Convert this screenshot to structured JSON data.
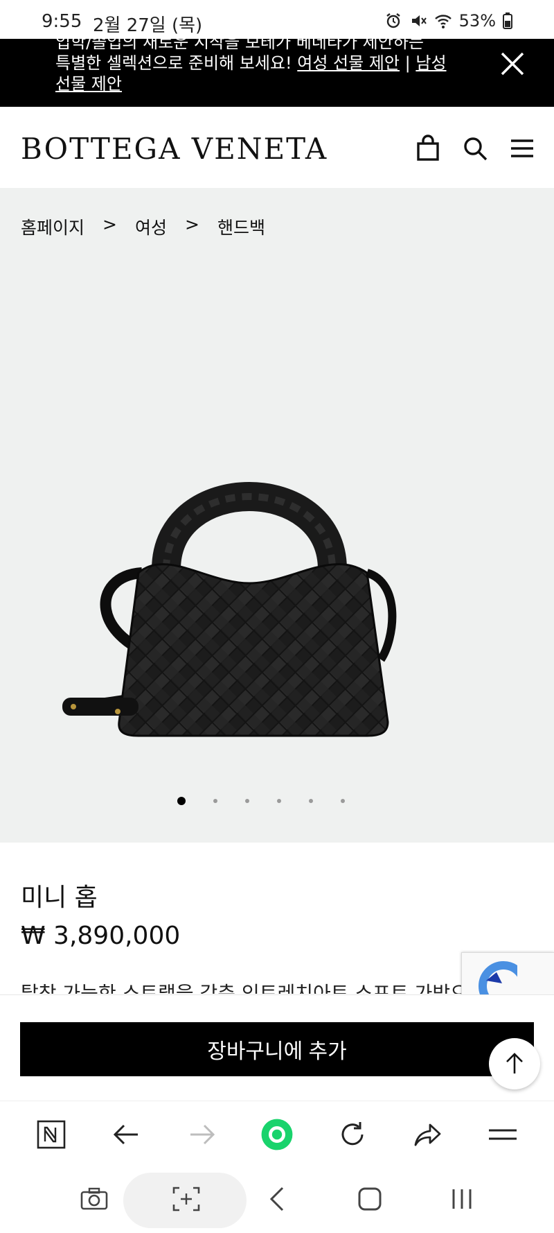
{
  "status_bar": {
    "time": "9:55",
    "date": "2월 27일 (목)",
    "battery": "53%"
  },
  "promo": {
    "line1": "입학/졸업의 새로운 시작을 보테가 베네타가 제안하는",
    "line2_prefix": "특별한 셀렉션으로 준비해 보세요! ",
    "women_link": "여성 선물 제안",
    "divider": " | ",
    "men_link": "남성 선물 제안"
  },
  "header": {
    "logo": "BOTTEGA VENETA",
    "icons": [
      "shopping-bag-icon",
      "search-icon",
      "menu-icon"
    ]
  },
  "breadcrumb": {
    "items": [
      "홈페이지",
      "여성",
      "핸드백"
    ],
    "separator": ">"
  },
  "gallery": {
    "slide_count": 6,
    "active_slide": 1
  },
  "product": {
    "name": "미니 홉",
    "price": "₩ 3,890,000",
    "description": "탈착 가능한 스트랩을 갖춘 인트레치아토 소프트 가방으로"
  },
  "cart": {
    "add_label": "장바구니에 추가"
  },
  "browser_toolbar": {
    "icons": [
      "naver-n-icon",
      "back-arrow-icon",
      "forward-arrow-icon",
      "home-dot-icon",
      "refresh-icon",
      "share-icon",
      "menu-icon"
    ]
  },
  "system_nav": {
    "icons": [
      "camera-icon",
      "scan-icon",
      "back-icon",
      "home-icon",
      "recents-icon"
    ]
  },
  "colors": {
    "banner_bg": "#000000",
    "gallery_bg": "#eff1f0",
    "button_bg": "#000000",
    "accent_green": "#19d36c"
  }
}
